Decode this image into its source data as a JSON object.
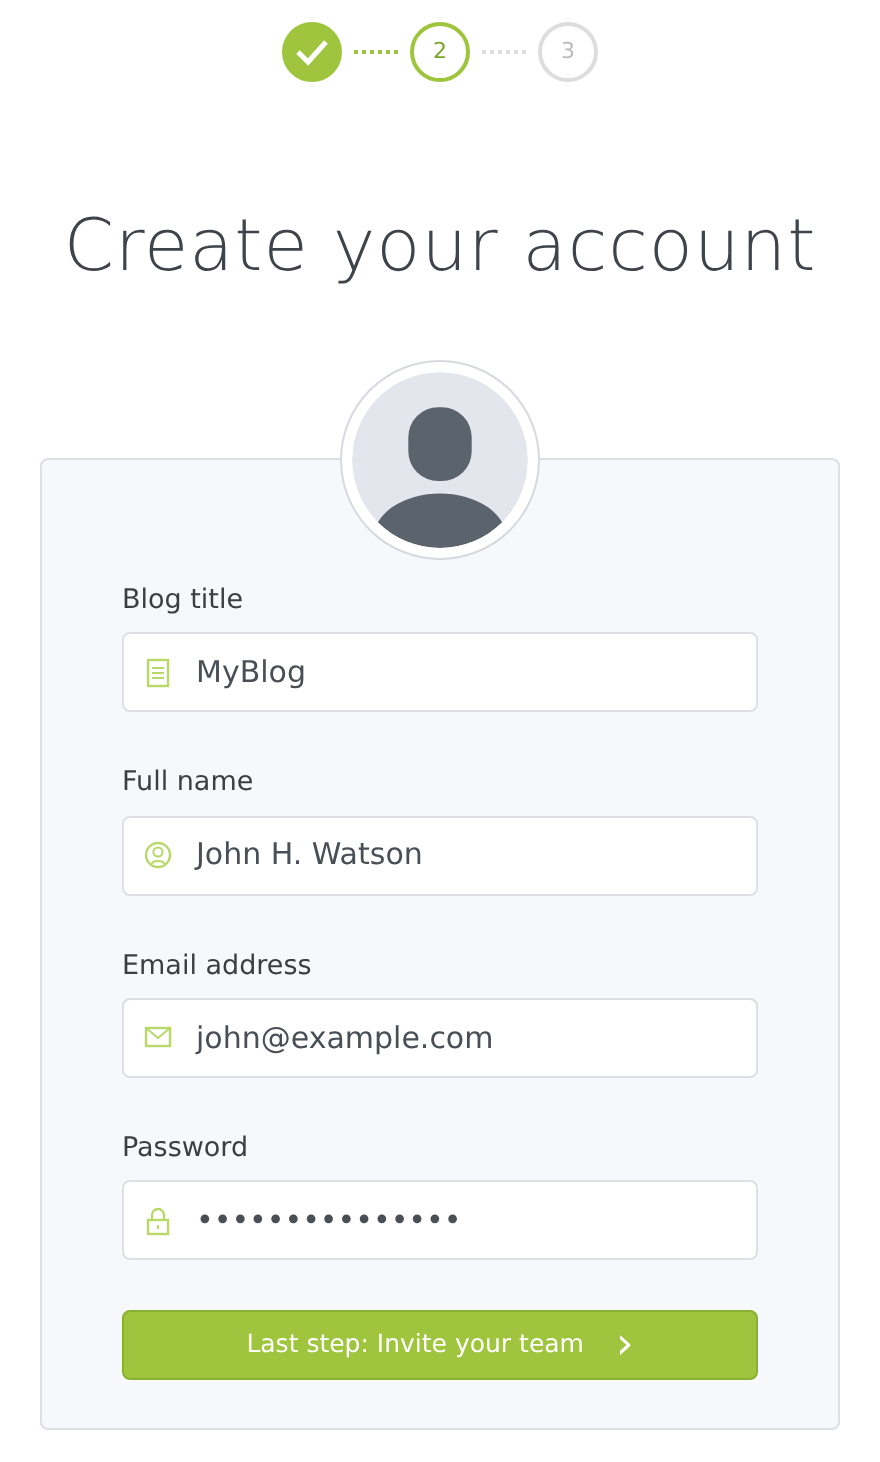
{
  "steps": [
    {
      "done": true,
      "selected": false
    },
    {
      "label": "2",
      "done": false,
      "selected": true
    },
    {
      "label": "3",
      "done": false,
      "selected": false
    }
  ],
  "title": "Create your account",
  "fields": [
    {
      "kind": "notepad",
      "label": "Blog title",
      "value": "MyBlog"
    },
    {
      "kind": "person",
      "label": "Full name",
      "value": "John H. Watson"
    },
    {
      "kind": "envelope",
      "label": "Email address",
      "value": "john@example.com"
    },
    {
      "kind": "lock",
      "label": "Password",
      "value": "•••••••••••••••"
    }
  ],
  "submit": {
    "label": "Last step: Invite your team",
    "icon": "›"
  }
}
